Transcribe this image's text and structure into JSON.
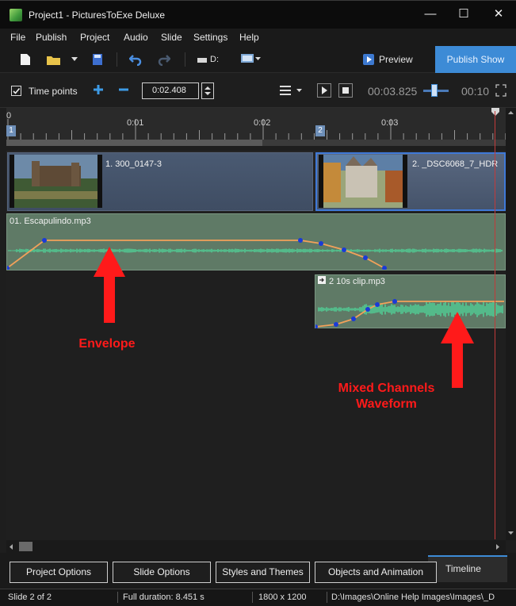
{
  "window": {
    "title": "Project1 - PicturesToExe Deluxe",
    "minimize": "—",
    "maximize": "☐",
    "close": "✕"
  },
  "menu": [
    "File",
    "Publish",
    "Project",
    "Audio",
    "Slide",
    "Settings",
    "Help"
  ],
  "toolbar": {
    "drive_label": "D:",
    "preview_label": "Preview",
    "publish_label": "Publish Show"
  },
  "timeline_bar": {
    "time_points_label": "Time points",
    "time_points_checked": true,
    "current_time_value": "0:02.408",
    "position_readout": "00:03.825",
    "zoom_readout": "00:10"
  },
  "ruler": {
    "labels": [
      "0",
      "0:01",
      "0:02",
      "0:03"
    ],
    "slide_markers": [
      "1",
      "2"
    ]
  },
  "slides": [
    {
      "number": "1",
      "label": "1. 300_0147-3",
      "selected": false
    },
    {
      "number": "2",
      "label": "2. _DSC6068_7_HDR",
      "selected": true
    }
  ],
  "audio_tracks": [
    {
      "label": "01. Escapulindo.mp3"
    },
    {
      "label": "2  10s clip.mp3"
    }
  ],
  "annotations": [
    {
      "text": "Envelope",
      "color": "#ff1a1a"
    },
    {
      "text": "Mixed Channels Waveform",
      "color": "#ff1a1a"
    }
  ],
  "bottom_tabs": [
    "Project Options",
    "Slide Options",
    "Styles and Themes",
    "Objects and Animation"
  ],
  "active_tab": "Timeline",
  "status": {
    "slide": "Slide 2 of 2",
    "duration": "Full duration: 8.451 s",
    "resolution": "1800 x 1200",
    "path": "D:\\Images\\Online Help Images\\Images\\_D"
  },
  "colors": {
    "accent": "#3d8bd6",
    "audio_track": "#5f7a66",
    "waveform": "#4fd69a",
    "envelope_line": "#f2a15a",
    "envelope_node": "#1a3ad8",
    "playhead": "#c23a3a"
  }
}
